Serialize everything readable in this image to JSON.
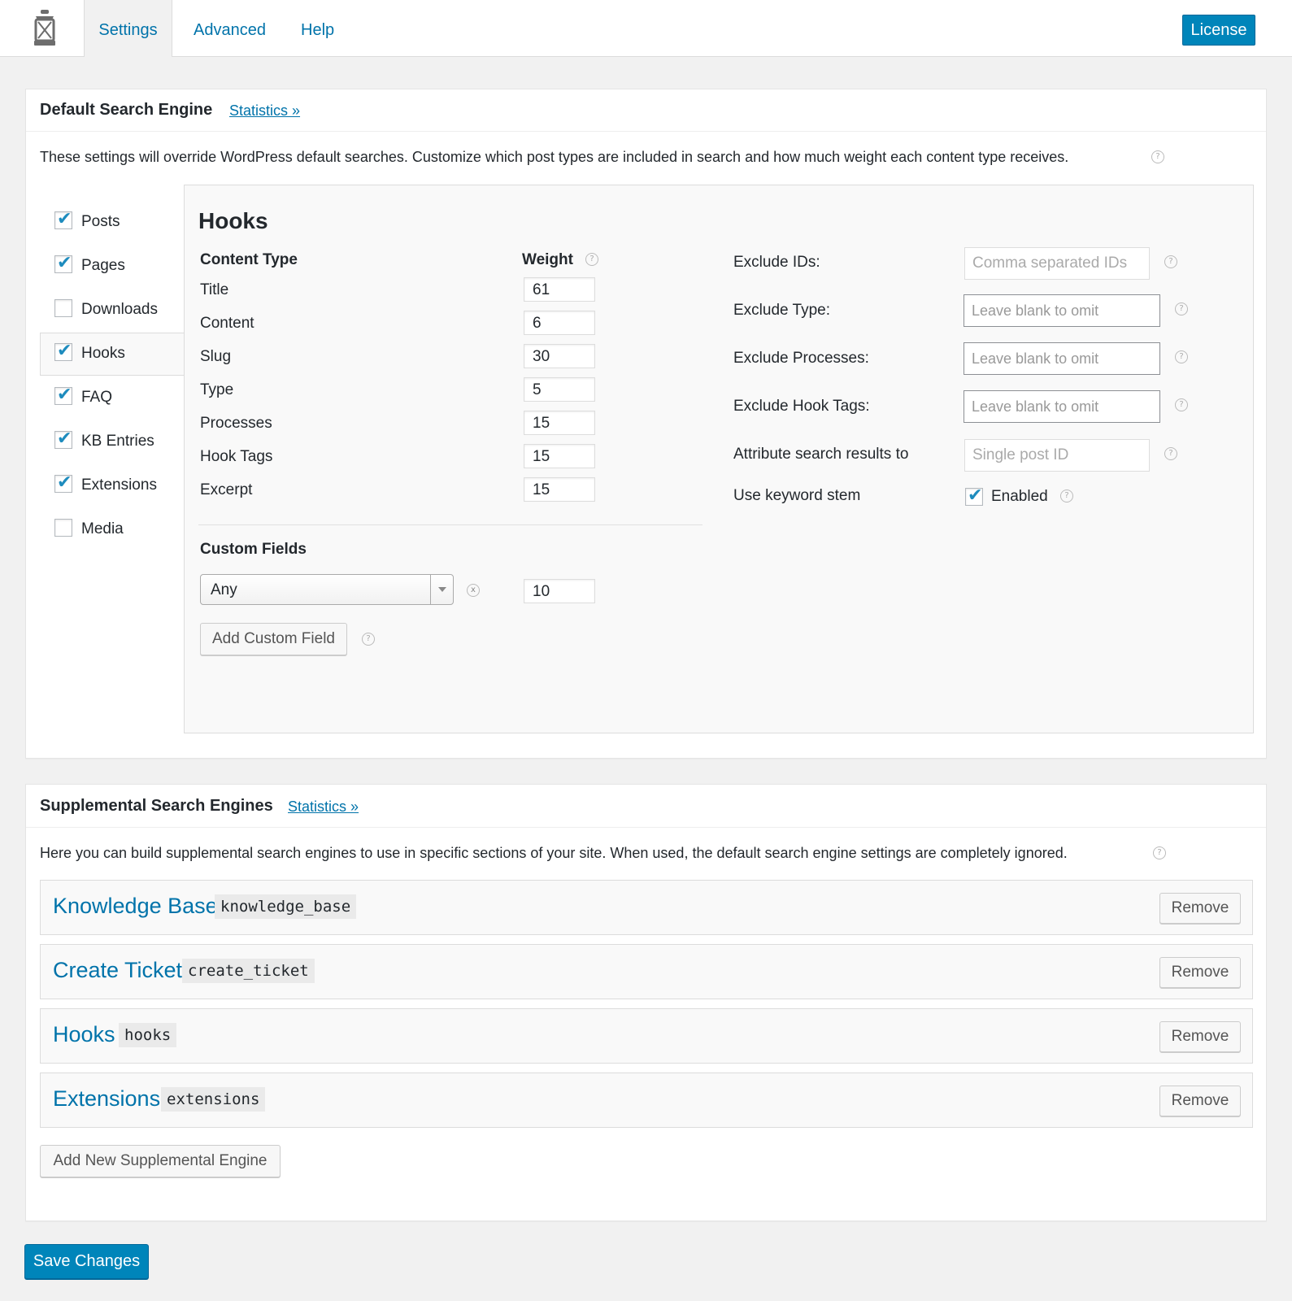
{
  "tabs": [
    {
      "label": "Settings",
      "active": true
    },
    {
      "label": "Advanced",
      "active": false
    },
    {
      "label": "Help",
      "active": false
    }
  ],
  "license_label": "License",
  "default_engine": {
    "title": "Default Search Engine",
    "stats_link": "Statistics »",
    "description": "These settings will override WordPress default searches. Customize which post types are included in search and how much weight each content type receives.",
    "post_types": [
      {
        "label": "Posts",
        "checked": true
      },
      {
        "label": "Pages",
        "checked": true
      },
      {
        "label": "Downloads",
        "checked": false
      },
      {
        "label": "Hooks",
        "checked": true,
        "active": true
      },
      {
        "label": "FAQ",
        "checked": true
      },
      {
        "label": "KB Entries",
        "checked": true
      },
      {
        "label": "Extensions",
        "checked": true
      },
      {
        "label": "Media",
        "checked": false
      }
    ],
    "detail": {
      "title": "Hooks",
      "content_type_header": "Content Type",
      "weight_header": "Weight",
      "weights": [
        {
          "label": "Title",
          "value": "61"
        },
        {
          "label": "Content",
          "value": "6"
        },
        {
          "label": "Slug",
          "value": "30"
        },
        {
          "label": "Type",
          "value": "5"
        },
        {
          "label": "Processes",
          "value": "15"
        },
        {
          "label": "Hook Tags",
          "value": "15"
        },
        {
          "label": "Excerpt",
          "value": "15"
        }
      ],
      "custom_fields_header": "Custom Fields",
      "custom_field_select": "Any",
      "custom_field_weight": "10",
      "add_custom_field": "Add Custom Field",
      "remove_glyph": "x",
      "options": [
        {
          "label": "Exclude IDs:",
          "placeholder": "Comma separated IDs"
        },
        {
          "label": "Exclude Type:",
          "placeholder": "Leave blank to omit"
        },
        {
          "label": "Exclude Processes:",
          "placeholder": "Leave blank to omit"
        },
        {
          "label": "Exclude Hook Tags:",
          "placeholder": "Leave blank to omit"
        },
        {
          "label": "Attribute search results to",
          "placeholder": "Single post ID"
        }
      ],
      "keyword_stem_label": "Use keyword stem",
      "keyword_stem_enabled": "Enabled"
    }
  },
  "supplemental": {
    "title": "Supplemental Search Engines",
    "stats_link": "Statistics »",
    "description": "Here you can build supplemental search engines to use in specific sections of your site. When used, the default search engine settings are completely ignored.",
    "engines": [
      {
        "name": "Knowledge Base",
        "slug": "knowledge_base"
      },
      {
        "name": "Create Ticket",
        "slug": "create_ticket"
      },
      {
        "name": "Hooks",
        "slug": "hooks"
      },
      {
        "name": "Extensions",
        "slug": "extensions"
      }
    ],
    "remove_label": "Remove",
    "add_label": "Add New Supplemental Engine"
  },
  "help_glyph": "?",
  "save_label": "Save Changes",
  "colors": {
    "accent": "#0073aa",
    "primary_button": "#0085ba",
    "check": "#1e8cbe"
  }
}
